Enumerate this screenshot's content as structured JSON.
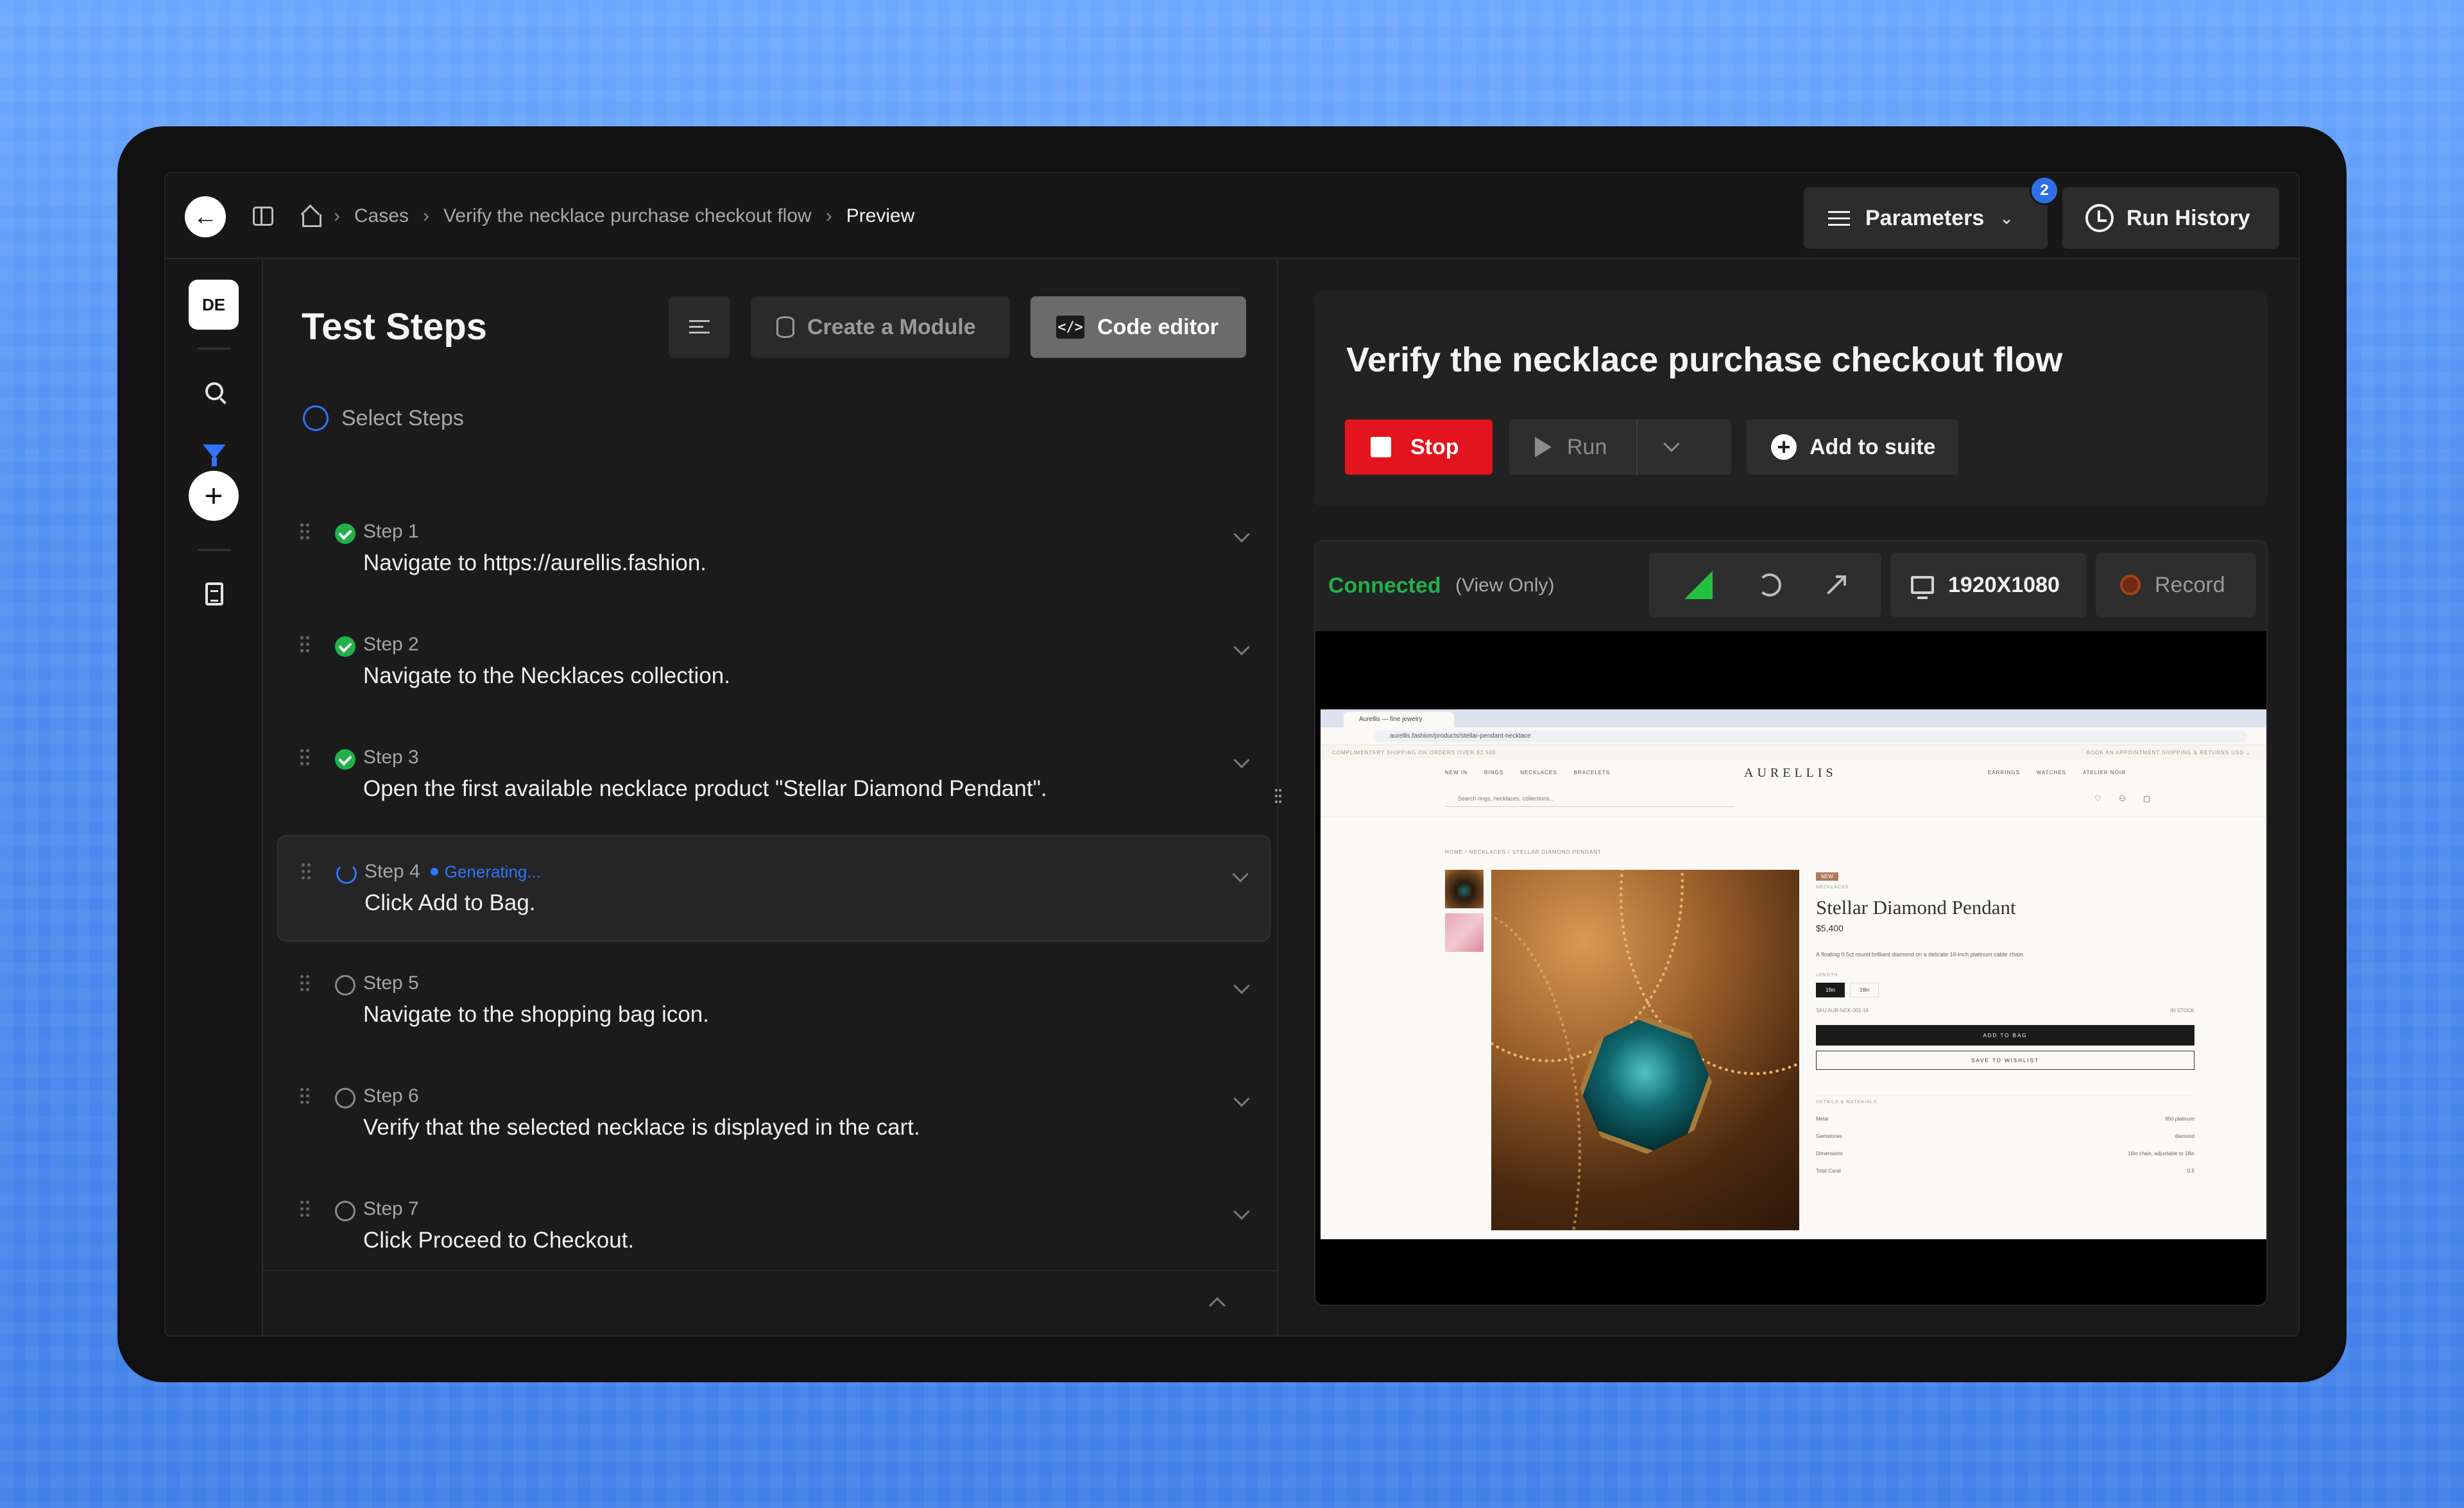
{
  "topbar": {
    "breadcrumb": [
      "Cases",
      "Verify the necklace purchase checkout flow",
      "Preview"
    ],
    "parameters_label": "Parameters",
    "parameters_badge": "2",
    "run_history_label": "Run History"
  },
  "rail": {
    "avatar_initials": "DE"
  },
  "steps_panel": {
    "title": "Test Steps",
    "create_module_label": "Create a Module",
    "code_editor_label": "Code editor",
    "select_steps_label": "Select Steps",
    "generating_label": "Generating...",
    "steps": [
      {
        "label": "Step 1",
        "text": "Navigate to https://aurellis.fashion.",
        "status": "done"
      },
      {
        "label": "Step 2",
        "text": "Navigate to the Necklaces collection.",
        "status": "done"
      },
      {
        "label": "Step 3",
        "text": "Open the first available necklace product \"Stellar Diamond Pendant\".",
        "status": "done"
      },
      {
        "label": "Step 4",
        "text": "Click Add to Bag.",
        "status": "generating"
      },
      {
        "label": "Step 5",
        "text": "Navigate to the shopping bag icon.",
        "status": "pending"
      },
      {
        "label": "Step 6",
        "text": "Verify that the selected necklace is displayed in the cart.",
        "status": "pending"
      },
      {
        "label": "Step 7",
        "text": "Click Proceed to Checkout.",
        "status": "pending"
      }
    ]
  },
  "case": {
    "title": "Verify the necklace purchase checkout flow",
    "stop_label": "Stop",
    "run_label": "Run",
    "add_to_suite_label": "Add to suite"
  },
  "preview": {
    "connection_status": "Connected",
    "view_mode": "(View Only)",
    "resolution": "1920X1080",
    "record_label": "Record",
    "colors": {
      "connected": "#22b04b",
      "stop": "#e3141d",
      "accent": "#2f74ff"
    }
  },
  "browser_screenshot": {
    "tab_title": "Aurellis — fine jewelry",
    "url": "aurellis.fashion/products/stellar-pendant-necklace",
    "promo_left": "COMPLIMENTARY SHIPPING ON ORDERS OVER $2,500",
    "promo_right": "BOOK AN APPOINTMENT   SHIPPING & RETURNS   USD ⌄",
    "nav_left": [
      "NEW IN",
      "RINGS",
      "NECKLACES",
      "BRACELETS"
    ],
    "brand": "AURELLIS",
    "nav_right": [
      "EARRINGS",
      "WATCHES",
      "ATELIER NOIR"
    ],
    "search_placeholder": "Search rings, necklaces, collections...",
    "crumb": "HOME / NECKLACES / STELLAR DIAMOND PENDANT",
    "badge_new": "NEW",
    "category": "NECKLACES",
    "product_name": "Stellar Diamond Pendant",
    "price": "$5,400",
    "description": "A floating 0.5ct round brilliant diamond on a delicate 16-inch platinum cable chain.",
    "length_label": "LENGTH",
    "sizes": [
      "16in",
      "18in"
    ],
    "sku": "SKU AUR-NCK-001-16",
    "stock": "IN STOCK",
    "add_to_bag": "ADD TO BAG",
    "save_to_wishlist": "SAVE TO WISHLIST",
    "details_label": "DETAILS & MATERIALS",
    "details": [
      {
        "k": "Metal",
        "v": "950 platinum"
      },
      {
        "k": "Gemstones",
        "v": "diamond"
      },
      {
        "k": "Dimensions",
        "v": "16in chain, adjustable to 18in"
      },
      {
        "k": "Total Carat",
        "v": "0.5"
      }
    ]
  }
}
